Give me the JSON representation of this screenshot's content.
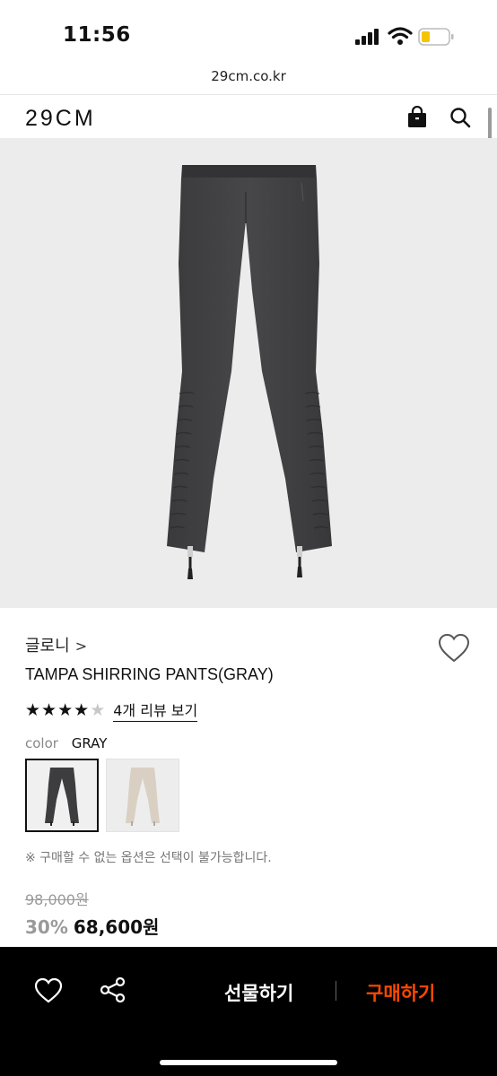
{
  "status": {
    "time": "11:56"
  },
  "browser": {
    "url": "29cm.co.kr"
  },
  "header": {
    "logo": "29CM"
  },
  "product": {
    "brand": "글로니",
    "brand_chevron": ">",
    "name": "TAMPA SHIRRING PANTS(GRAY)",
    "rating": 4,
    "rating_max": 5,
    "review_link": "4개 리뷰 보기",
    "color_label": "color",
    "color_value": "GRAY",
    "notice": "※ 구매할 수 없는 옵션은 선택이 불가능합니다.",
    "original_price": "98,000원",
    "discount": "30%",
    "final_price": "68,600원",
    "swatches": [
      "gray",
      "beige"
    ]
  },
  "bottom_bar": {
    "gift_label": "선물하기",
    "buy_label": "구매하기"
  },
  "colors": {
    "accent": "#ff4800",
    "pants_gray": "#3d3d3f",
    "pants_beige": "#d9d0c3"
  }
}
